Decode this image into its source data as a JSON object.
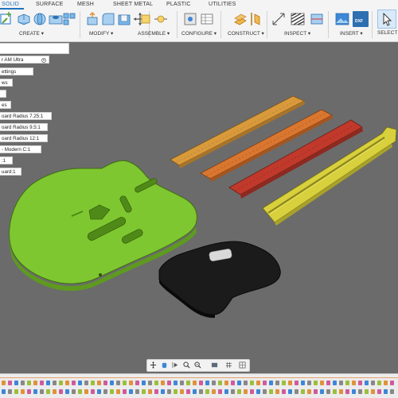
{
  "ribbon": {
    "tabs": [
      {
        "label": "SOLID",
        "active": true
      },
      {
        "label": "SURFACE"
      },
      {
        "label": "MESH"
      },
      {
        "label": "SHEET METAL"
      },
      {
        "label": "PLASTIC"
      },
      {
        "label": "UTILITIES"
      }
    ],
    "groups": [
      {
        "label": "CREATE ▾"
      },
      {
        "label": "MODIFY ▾"
      },
      {
        "label": "ASSEMBLE ▾"
      },
      {
        "label": "CONFIGURE ▾"
      },
      {
        "label": "CONSTRUCT ▾"
      },
      {
        "label": "INSPECT ▾"
      },
      {
        "label": "INSERT ▾"
      },
      {
        "label": "SELECT"
      }
    ],
    "insert_icon_text": "DXF"
  },
  "browser": {
    "items": [
      {
        "label": "r AM Ultra"
      },
      {
        "label": "ettings"
      },
      {
        "label": "ws"
      },
      {
        "label": ""
      },
      {
        "label": "es"
      },
      {
        "label": "oard Radius 7.25:1"
      },
      {
        "label": "oard Radius 9.5:1"
      },
      {
        "label": "oard Radius 12:1"
      },
      {
        "label": "- Modern C:1"
      },
      {
        "label": ":1"
      },
      {
        "label": "uard:1"
      }
    ]
  },
  "viewport": {
    "body_color": "#7ec730",
    "pickguard_color": "#1b1b1b",
    "neck_colors": [
      "#d99a3c",
      "#d9762f",
      "#c0392b",
      "#d8d03c"
    ],
    "background": "#6b6b6b"
  },
  "navbar": {
    "icons": [
      "orbit-icon",
      "pan-icon",
      "look-at-icon",
      "zoom-icon",
      "zoom-window-icon",
      "display-settings-icon",
      "grid-settings-icon",
      "viewports-icon"
    ]
  },
  "timeline": {
    "colors": [
      "#e0923a",
      "#3c87d6",
      "#9bbf3b",
      "#d05a9c",
      "#888888"
    ]
  }
}
